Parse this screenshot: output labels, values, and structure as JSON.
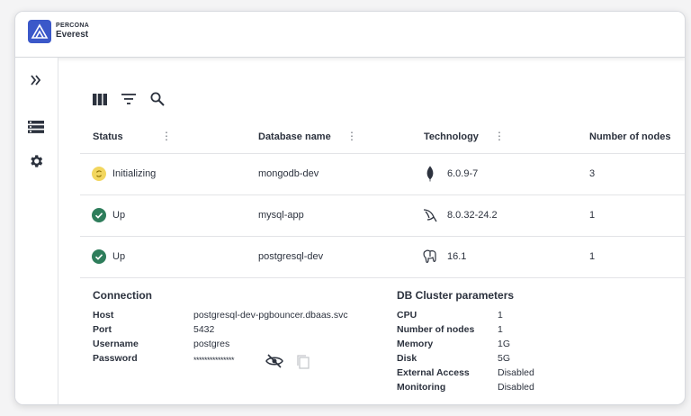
{
  "brand": {
    "top": "PERCONA",
    "main": "Everest"
  },
  "table": {
    "headers": [
      "Status",
      "Database name",
      "Technology",
      "Number of nodes"
    ],
    "rows": [
      {
        "status": "Initializing",
        "status_kind": "initializing",
        "name": "mongodb-dev",
        "tech_icon": "mongodb-icon",
        "version": "6.0.9-7",
        "nodes": "3"
      },
      {
        "status": "Up",
        "status_kind": "up",
        "name": "mysql-app",
        "tech_icon": "mysql-icon",
        "version": "8.0.32-24.2",
        "nodes": "1"
      },
      {
        "status": "Up",
        "status_kind": "up",
        "name": "postgresql-dev",
        "tech_icon": "postgresql-icon",
        "version": "16.1",
        "nodes": "1"
      }
    ]
  },
  "connection": {
    "title": "Connection",
    "host_label": "Host",
    "host": "postgresql-dev-pgbouncer.dbaas.svc",
    "port_label": "Port",
    "port": "5432",
    "username_label": "Username",
    "username": "postgres",
    "password_label": "Password",
    "password": "***************"
  },
  "params": {
    "title": "DB Cluster parameters",
    "items": [
      {
        "label": "CPU",
        "value": "1"
      },
      {
        "label": "Number of nodes",
        "value": "1"
      },
      {
        "label": "Memory",
        "value": "1G"
      },
      {
        "label": "Disk",
        "value": "5G"
      },
      {
        "label": "External Access",
        "value": "Disabled"
      },
      {
        "label": "Monitoring",
        "value": "Disabled"
      }
    ]
  },
  "colors": {
    "accent": "#3b58c9",
    "status_up": "#2e7d5b",
    "status_init": "#f2d65e"
  }
}
